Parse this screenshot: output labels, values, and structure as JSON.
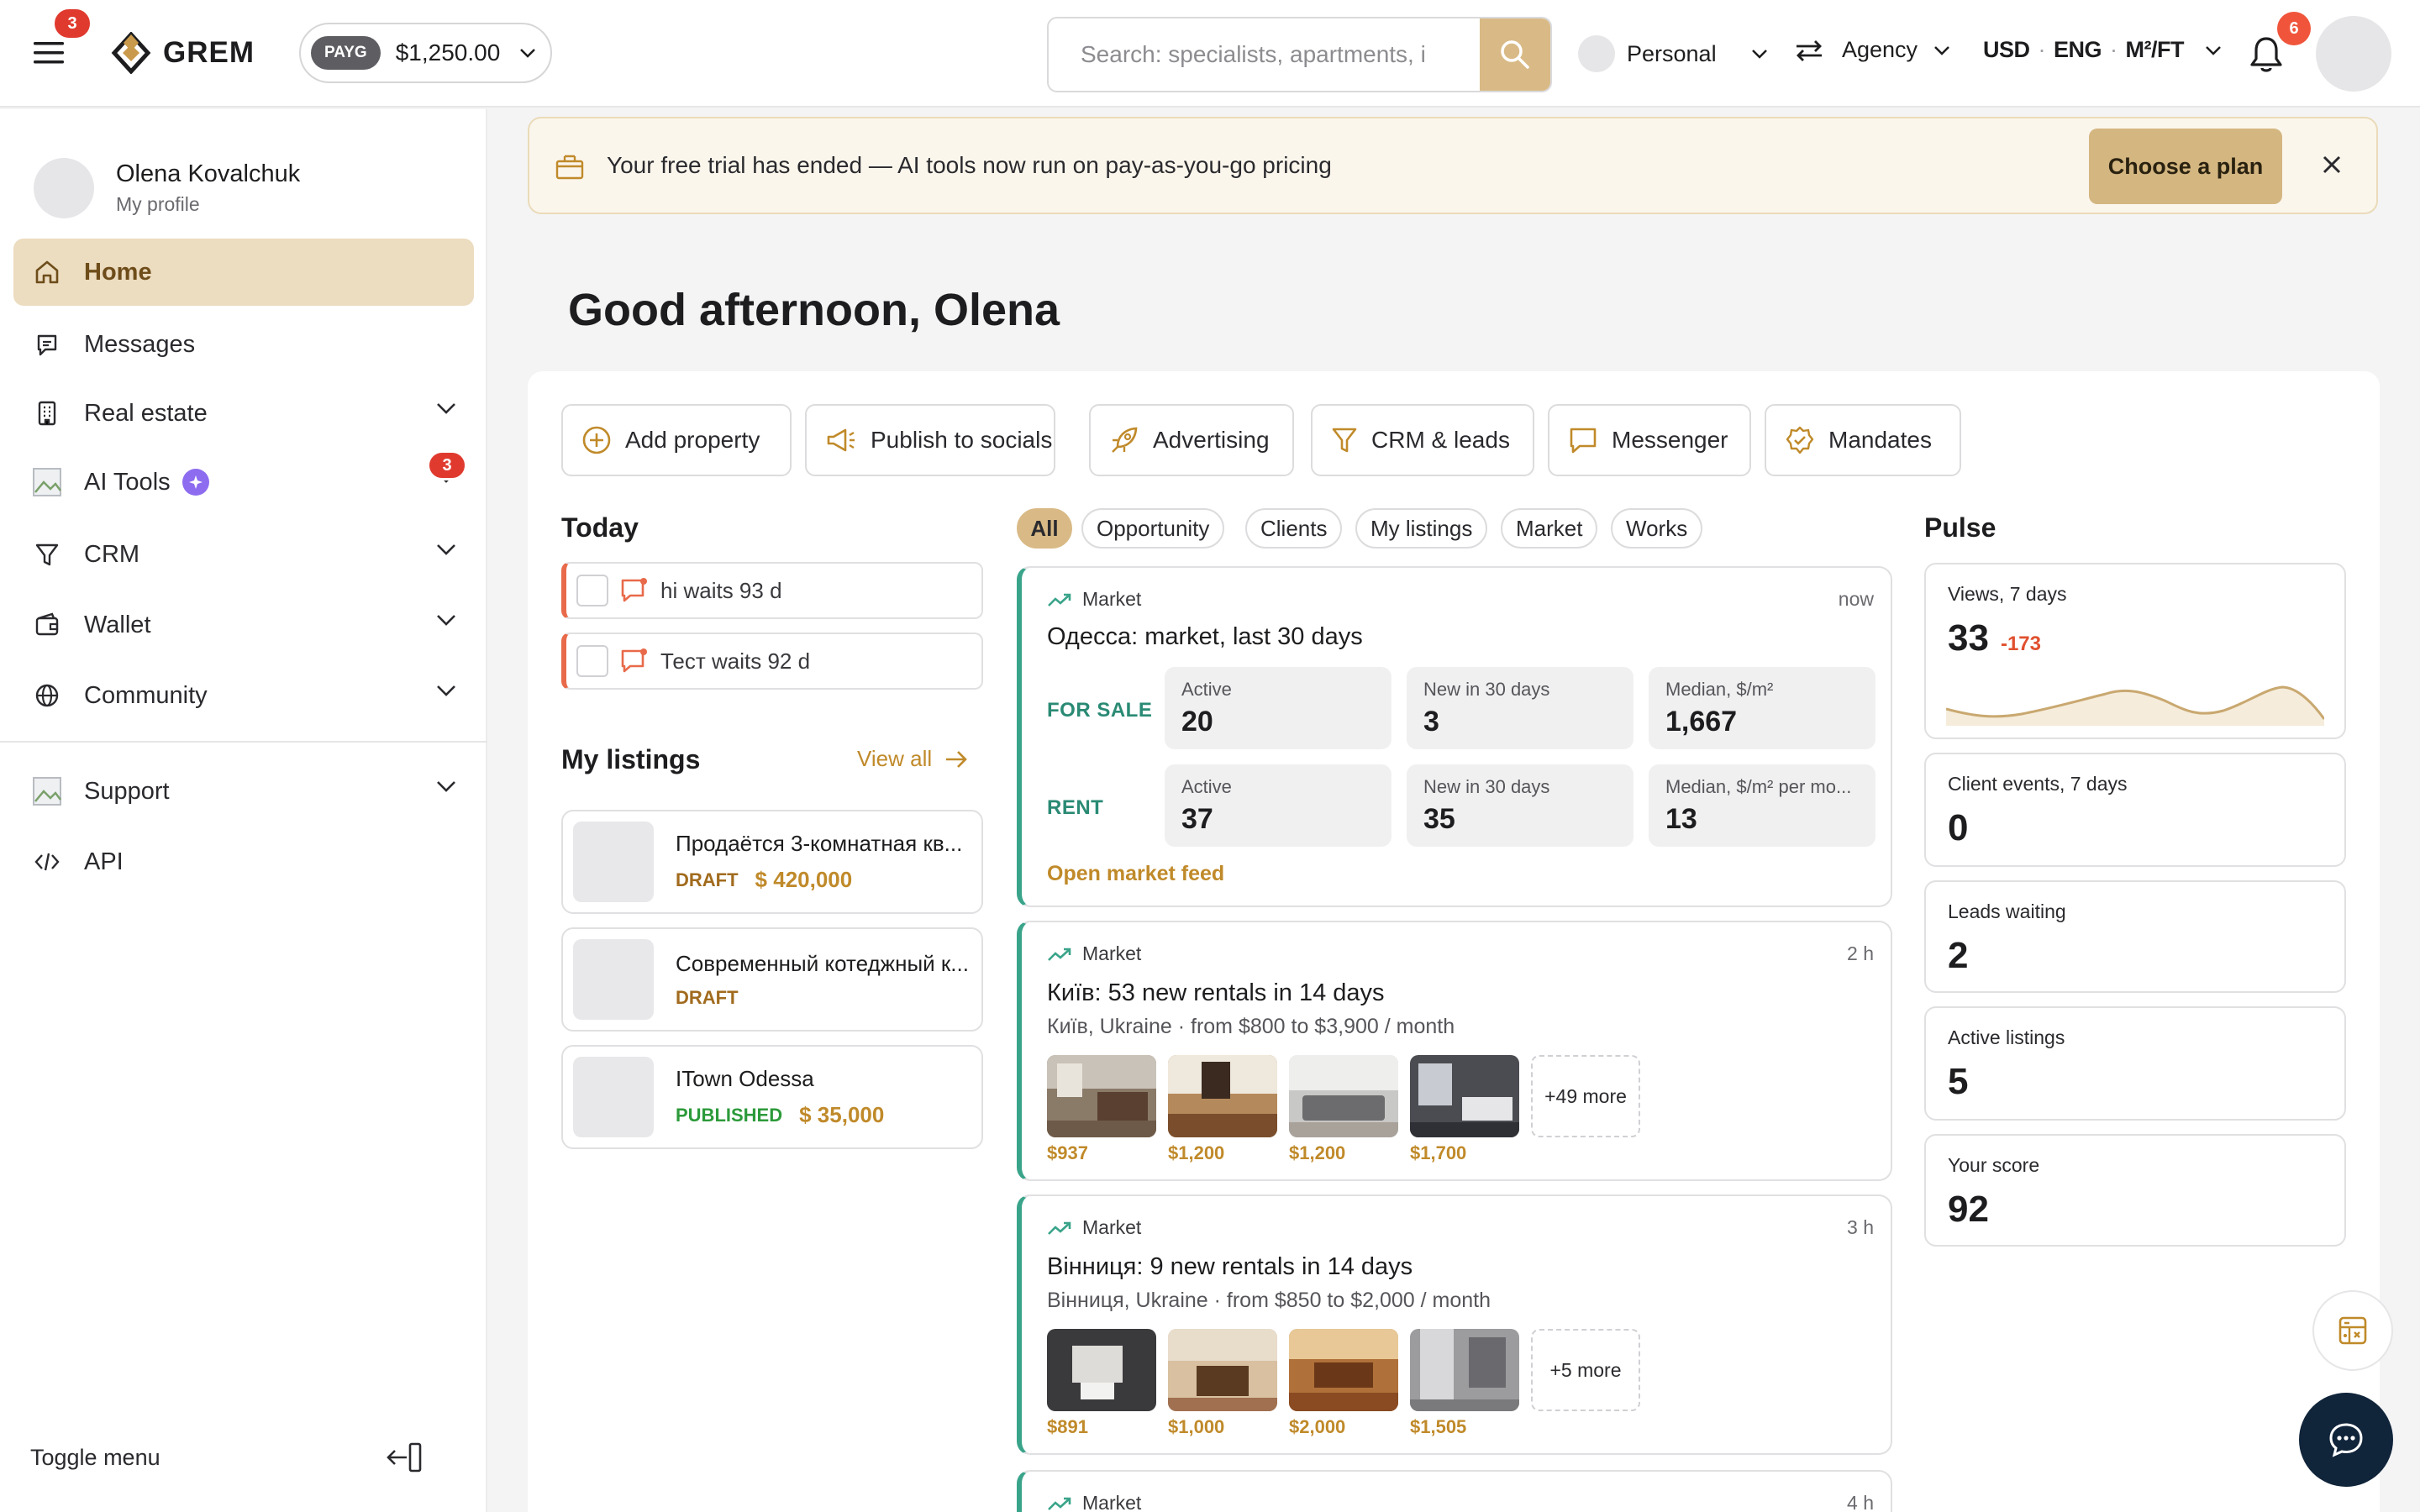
{
  "topbar": {
    "menu_badge": "3",
    "logo_text": "GREM",
    "payg_label": "PAYG",
    "balance": "$1,250.00",
    "search_placeholder": "Search: specialists, apartments, i",
    "account_mode": "Personal",
    "role": "Agency",
    "currency": "USD",
    "language": "ENG",
    "unit": "M²/FT",
    "notifications_count": "6"
  },
  "sidebar": {
    "profile_name": "Olena Kovalchuk",
    "profile_sub": "My profile",
    "items": [
      {
        "label": "Home",
        "icon": "home-icon",
        "active": true
      },
      {
        "label": "Messages",
        "icon": "chat-icon"
      },
      {
        "label": "Real estate",
        "icon": "building-icon"
      },
      {
        "label": "AI Tools",
        "icon": "ai-tools-icon",
        "badge": "3"
      },
      {
        "label": "CRM",
        "icon": "funnel-icon"
      },
      {
        "label": "Wallet",
        "icon": "wallet-icon"
      },
      {
        "label": "Community",
        "icon": "globe-icon"
      },
      {
        "label": "Support",
        "icon": "support-icon"
      },
      {
        "label": "API",
        "icon": "code-icon"
      }
    ],
    "toggle_label": "Toggle menu"
  },
  "banner": {
    "text": "Your free trial has ended — AI tools now run on pay-as-you-go pricing",
    "button": "Choose a plan"
  },
  "greeting": "Good afternoon, Olena",
  "quick_actions": [
    "Add property",
    "Publish to socials",
    "Advertising",
    "CRM & leads",
    "Messenger",
    "Mandates"
  ],
  "today": {
    "title": "Today",
    "tasks": [
      "hi waits 93 d",
      "Тест waits 92 d"
    ]
  },
  "my_listings": {
    "title": "My listings",
    "view_all": "View all",
    "items": [
      {
        "title": "Продаётся 3-комнатная кв...",
        "status": "DRAFT",
        "price": "$ 420,000"
      },
      {
        "title": "Современный котеджный к...",
        "status": "DRAFT",
        "price": ""
      },
      {
        "title": "ITown Odessa",
        "status": "PUBLISHED",
        "price": "$ 35,000"
      }
    ]
  },
  "filters": [
    "All",
    "Opportunity",
    "Clients",
    "My listings",
    "Market",
    "Works"
  ],
  "feed": [
    {
      "tag": "Market",
      "time": "now",
      "title": "Одесса: market, last 30 days",
      "sale_label": "FOR SALE",
      "rent_label": "RENT",
      "sale": [
        {
          "label": "Active",
          "value": "20"
        },
        {
          "label": "New in 30 days",
          "value": "3"
        },
        {
          "label": "Median, $/m²",
          "value": "1,667"
        }
      ],
      "rent": [
        {
          "label": "Active",
          "value": "37"
        },
        {
          "label": "New in 30 days",
          "value": "35"
        },
        {
          "label": "Median, $/m² per mo...",
          "value": "13"
        }
      ],
      "link": "Open market feed"
    },
    {
      "tag": "Market",
      "time": "2 h",
      "title": "Київ: 53 new rentals in 14 days",
      "subtitle": "Київ, Ukraine · from $800 to $3,900 / month",
      "prices": [
        "$937",
        "$1,200",
        "$1,200",
        "$1,700"
      ],
      "more": "+49 more"
    },
    {
      "tag": "Market",
      "time": "3 h",
      "title": "Вінниця: 9 new rentals in 14 days",
      "subtitle": "Вінниця, Ukraine · from $850 to $2,000 / month",
      "prices": [
        "$891",
        "$1,000",
        "$2,000",
        "$1,505"
      ],
      "more": "+5 more"
    },
    {
      "tag": "Market",
      "time": "4 h"
    }
  ],
  "pulse": {
    "title": "Pulse",
    "cards": [
      {
        "label": "Views, 7 days",
        "value": "33",
        "delta": "-173"
      },
      {
        "label": "Client events, 7 days",
        "value": "0"
      },
      {
        "label": "Leads waiting",
        "value": "2"
      },
      {
        "label": "Active listings",
        "value": "5"
      },
      {
        "label": "Your score",
        "value": "92"
      }
    ]
  },
  "colors": {
    "accent": "#d9ba86",
    "accent_dark": "#c08a2a",
    "market": "#3aa48a",
    "alert": "#e03a2f"
  }
}
